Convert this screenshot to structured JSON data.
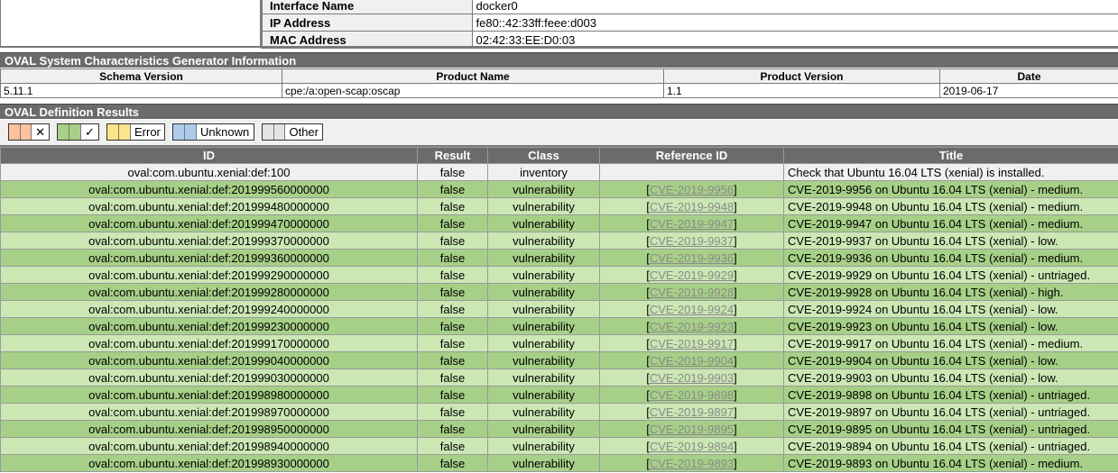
{
  "interface": {
    "rows": [
      {
        "label": "Interface Name",
        "value": "docker0"
      },
      {
        "label": "IP Address",
        "value": "fe80::42:33ff:feee:d003"
      },
      {
        "label": "MAC Address",
        "value": "02:42:33:EE:D0:03"
      }
    ]
  },
  "generator": {
    "title": "OVAL System Characteristics Generator Information",
    "headers": [
      "Schema Version",
      "Product Name",
      "Product Version",
      "Date"
    ],
    "values": [
      "5.11.1",
      "cpe:/a:open-scap:oscap",
      "1.1",
      "2019-06-17"
    ]
  },
  "definitions": {
    "title": "OVAL Definition Results",
    "legend": [
      {
        "label": "✕",
        "color": "#ffc09f"
      },
      {
        "label": "✓",
        "color": "#a6d087"
      },
      {
        "label": "Error",
        "color": "#ffe487"
      },
      {
        "label": "Unknown",
        "color": "#aecbec"
      },
      {
        "label": "Other",
        "color": "#e3e3e3"
      }
    ],
    "headers": [
      "ID",
      "Result",
      "Class",
      "Reference ID",
      "Title"
    ],
    "rows": [
      {
        "id": "oval:com.ubuntu.xenial:def:100",
        "result": "false",
        "class": "inventory",
        "ref": "",
        "title": "Check that Ubuntu 16.04 LTS (xenial) is installed."
      },
      {
        "id": "oval:com.ubuntu.xenial:def:201999560000000",
        "result": "false",
        "class": "vulnerability",
        "ref": "CVE-2019-9956",
        "title": "CVE-2019-9956 on Ubuntu 16.04 LTS (xenial) - medium."
      },
      {
        "id": "oval:com.ubuntu.xenial:def:201999480000000",
        "result": "false",
        "class": "vulnerability",
        "ref": "CVE-2019-9948",
        "title": "CVE-2019-9948 on Ubuntu 16.04 LTS (xenial) - medium."
      },
      {
        "id": "oval:com.ubuntu.xenial:def:201999470000000",
        "result": "false",
        "class": "vulnerability",
        "ref": "CVE-2019-9947",
        "title": "CVE-2019-9947 on Ubuntu 16.04 LTS (xenial) - medium."
      },
      {
        "id": "oval:com.ubuntu.xenial:def:201999370000000",
        "result": "false",
        "class": "vulnerability",
        "ref": "CVE-2019-9937",
        "title": "CVE-2019-9937 on Ubuntu 16.04 LTS (xenial) - low."
      },
      {
        "id": "oval:com.ubuntu.xenial:def:201999360000000",
        "result": "false",
        "class": "vulnerability",
        "ref": "CVE-2019-9936",
        "title": "CVE-2019-9936 on Ubuntu 16.04 LTS (xenial) - medium."
      },
      {
        "id": "oval:com.ubuntu.xenial:def:201999290000000",
        "result": "false",
        "class": "vulnerability",
        "ref": "CVE-2019-9929",
        "title": "CVE-2019-9929 on Ubuntu 16.04 LTS (xenial) - untriaged."
      },
      {
        "id": "oval:com.ubuntu.xenial:def:201999280000000",
        "result": "false",
        "class": "vulnerability",
        "ref": "CVE-2019-9928",
        "title": "CVE-2019-9928 on Ubuntu 16.04 LTS (xenial) - high."
      },
      {
        "id": "oval:com.ubuntu.xenial:def:201999240000000",
        "result": "false",
        "class": "vulnerability",
        "ref": "CVE-2019-9924",
        "title": "CVE-2019-9924 on Ubuntu 16.04 LTS (xenial) - low."
      },
      {
        "id": "oval:com.ubuntu.xenial:def:201999230000000",
        "result": "false",
        "class": "vulnerability",
        "ref": "CVE-2019-9923",
        "title": "CVE-2019-9923 on Ubuntu 16.04 LTS (xenial) - low."
      },
      {
        "id": "oval:com.ubuntu.xenial:def:201999170000000",
        "result": "false",
        "class": "vulnerability",
        "ref": "CVE-2019-9917",
        "title": "CVE-2019-9917 on Ubuntu 16.04 LTS (xenial) - medium."
      },
      {
        "id": "oval:com.ubuntu.xenial:def:201999040000000",
        "result": "false",
        "class": "vulnerability",
        "ref": "CVE-2019-9904",
        "title": "CVE-2019-9904 on Ubuntu 16.04 LTS (xenial) - low."
      },
      {
        "id": "oval:com.ubuntu.xenial:def:201999030000000",
        "result": "false",
        "class": "vulnerability",
        "ref": "CVE-2019-9903",
        "title": "CVE-2019-9903 on Ubuntu 16.04 LTS (xenial) - low."
      },
      {
        "id": "oval:com.ubuntu.xenial:def:201998980000000",
        "result": "false",
        "class": "vulnerability",
        "ref": "CVE-2019-9898",
        "title": "CVE-2019-9898 on Ubuntu 16.04 LTS (xenial) - untriaged."
      },
      {
        "id": "oval:com.ubuntu.xenial:def:201998970000000",
        "result": "false",
        "class": "vulnerability",
        "ref": "CVE-2019-9897",
        "title": "CVE-2019-9897 on Ubuntu 16.04 LTS (xenial) - untriaged."
      },
      {
        "id": "oval:com.ubuntu.xenial:def:201998950000000",
        "result": "false",
        "class": "vulnerability",
        "ref": "CVE-2019-9895",
        "title": "CVE-2019-9895 on Ubuntu 16.04 LTS (xenial) - untriaged."
      },
      {
        "id": "oval:com.ubuntu.xenial:def:201998940000000",
        "result": "false",
        "class": "vulnerability",
        "ref": "CVE-2019-9894",
        "title": "CVE-2019-9894 on Ubuntu 16.04 LTS (xenial) - untriaged."
      },
      {
        "id": "oval:com.ubuntu.xenial:def:201998930000000",
        "result": "false",
        "class": "vulnerability",
        "ref": "CVE-2019-9893",
        "title": "CVE-2019-9893 on Ubuntu 16.04 LTS (xenial) - medium."
      }
    ]
  }
}
